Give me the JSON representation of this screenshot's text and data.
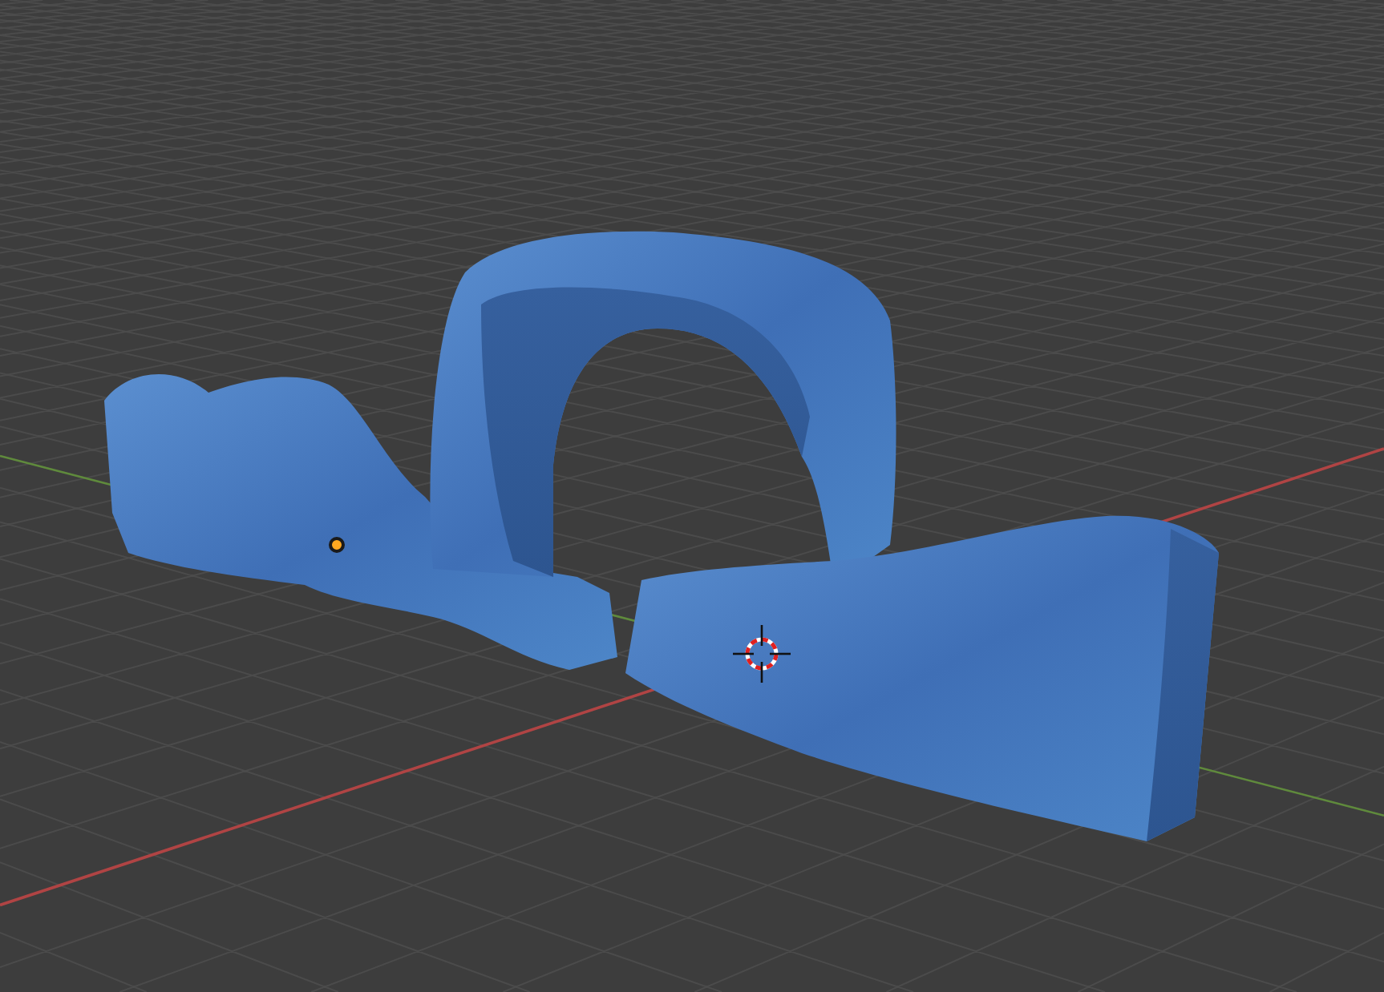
{
  "viewport": {
    "show_grid": true,
    "show_axes": true,
    "show_cursor": true,
    "show_origin": true
  }
}
